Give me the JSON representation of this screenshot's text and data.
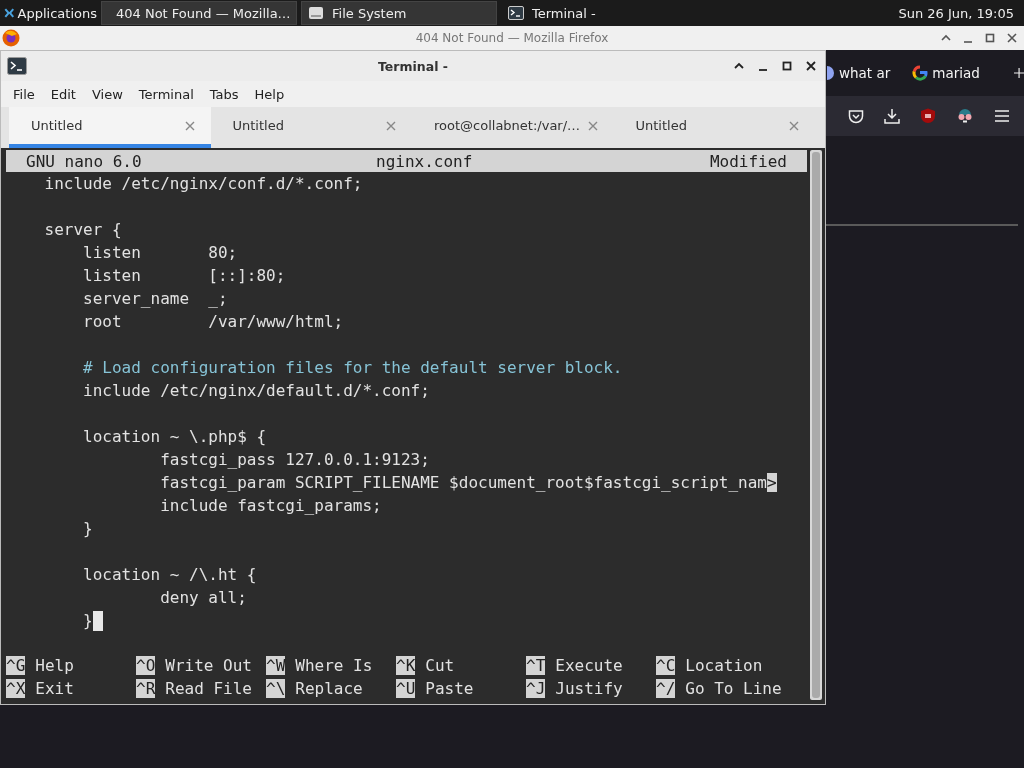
{
  "panel": {
    "menu": "Applications",
    "tasks": [
      {
        "kind": "browser",
        "title": "404 Not Found — Mozilla…",
        "selected": false
      },
      {
        "kind": "drive",
        "title": "File System",
        "selected": false
      },
      {
        "kind": "terminal",
        "title": "Terminal -",
        "selected": true
      }
    ],
    "clock": "Sun 26 Jun, 19:05"
  },
  "browser_window": {
    "title": "404 Not Found — Mozilla Firefox",
    "tabs": [
      {
        "kind": "globe",
        "title": "what ar"
      },
      {
        "kind": "ring",
        "title": "mariad"
      }
    ]
  },
  "terminal_window": {
    "title": "Terminal -",
    "menu": [
      "File",
      "Edit",
      "View",
      "Terminal",
      "Tabs",
      "Help"
    ],
    "tabs": [
      {
        "label": "Untitled",
        "selected": true
      },
      {
        "label": "Untitled",
        "selected": false
      },
      {
        "label": "root@collabnet:/var/…",
        "selected": false
      },
      {
        "label": "Untitled",
        "selected": false
      }
    ],
    "nano": {
      "version": "GNU nano 6.0",
      "filename": "nginx.conf",
      "status": "Modified",
      "lines": [
        {
          "kind": "code",
          "text": "    include /etc/nginx/conf.d/*.conf;",
          "cursor": false
        },
        {
          "kind": "blank",
          "cursor": false
        },
        {
          "kind": "code",
          "text": "    server {",
          "cursor": false
        },
        {
          "kind": "code",
          "text": "        listen       80;",
          "cursor": false
        },
        {
          "kind": "code",
          "text": "        listen       [::]:80;",
          "cursor": false
        },
        {
          "kind": "code",
          "text": "        server_name  _;",
          "cursor": false
        },
        {
          "kind": "code",
          "text": "        root         /var/www/html;",
          "cursor": false
        },
        {
          "kind": "blank",
          "cursor": false
        },
        {
          "kind": "comment",
          "text": "        # Load configuration files for the default server block.",
          "cursor": false
        },
        {
          "kind": "code",
          "text": "        include /etc/nginx/default.d/*.conf;",
          "cursor": false
        },
        {
          "kind": "blank",
          "cursor": false
        },
        {
          "kind": "code",
          "text": "        location ~ \\.php$ {",
          "cursor": false
        },
        {
          "kind": "code",
          "text": "                fastcgi_pass 127.0.0.1:9123;",
          "cursor": false
        },
        {
          "kind": "cut",
          "text": "                fastcgi_param SCRIPT_FILENAME $document_root$fastcgi_script_nam",
          "mark": ">",
          "cursor": false
        },
        {
          "kind": "code",
          "text": "                include fastcgi_params;",
          "cursor": false
        },
        {
          "kind": "code",
          "text": "        }",
          "cursor": false
        },
        {
          "kind": "blank",
          "cursor": false
        },
        {
          "kind": "code",
          "text": "        location ~ /\\.ht {",
          "cursor": false
        },
        {
          "kind": "code",
          "text": "                deny all;",
          "cursor": false
        },
        {
          "kind": "code",
          "text": "        }",
          "cursor": true
        },
        {
          "kind": "blank",
          "cursor": false
        }
      ],
      "shortcuts": [
        {
          "key": "^G",
          "label": "Help"
        },
        {
          "key": "^O",
          "label": "Write Out"
        },
        {
          "key": "^W",
          "label": "Where Is"
        },
        {
          "key": "^K",
          "label": "Cut"
        },
        {
          "key": "^T",
          "label": "Execute"
        },
        {
          "key": "^C",
          "label": "Location"
        },
        {
          "key": "^X",
          "label": "Exit"
        },
        {
          "key": "^R",
          "label": "Read File"
        },
        {
          "key": "^\\",
          "label": "Replace"
        },
        {
          "key": "^U",
          "label": "Paste"
        },
        {
          "key": "^J",
          "label": "Justify"
        },
        {
          "key": "^/",
          "label": "Go To Line"
        }
      ]
    }
  }
}
